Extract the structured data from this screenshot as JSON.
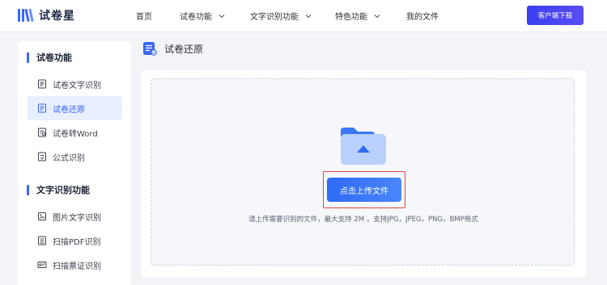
{
  "header": {
    "logo_text": "试卷星",
    "nav": [
      {
        "label": "首页",
        "has_dropdown": false
      },
      {
        "label": "试卷功能",
        "has_dropdown": true
      },
      {
        "label": "文字识别功能",
        "has_dropdown": true
      },
      {
        "label": "特色功能",
        "has_dropdown": true
      },
      {
        "label": "我的文件",
        "has_dropdown": false
      }
    ],
    "cta_label": "客户端下载"
  },
  "sidebar": {
    "groups": [
      {
        "title": "试卷功能",
        "items": [
          {
            "label": "试卷文字识别",
            "icon": "scan-doc-icon",
            "active": false
          },
          {
            "label": "试卷还原",
            "icon": "restore-doc-icon",
            "active": true
          },
          {
            "label": "试卷转Word",
            "icon": "doc-convert-icon",
            "active": false
          },
          {
            "label": "公式识别",
            "icon": "formula-icon",
            "active": false
          }
        ]
      },
      {
        "title": "文字识别功能",
        "items": [
          {
            "label": "图片文字识别",
            "icon": "image-text-icon",
            "active": false
          },
          {
            "label": "扫描PDF识别",
            "icon": "pdf-scan-icon",
            "active": false
          },
          {
            "label": "扫描票证识别",
            "icon": "card-scan-icon",
            "active": false
          }
        ]
      }
    ]
  },
  "main": {
    "title": "试卷还原",
    "upload_button": "点击上传文件",
    "hint": "请上传需要识别的文件，最大支持 2M ，支持JPG，JPEG，PNG，BMP格式"
  },
  "colors": {
    "accent": "#3b66f5",
    "cta": "#4a45f2",
    "highlight_border": "#e2463b",
    "background": "#f2f4f8"
  }
}
